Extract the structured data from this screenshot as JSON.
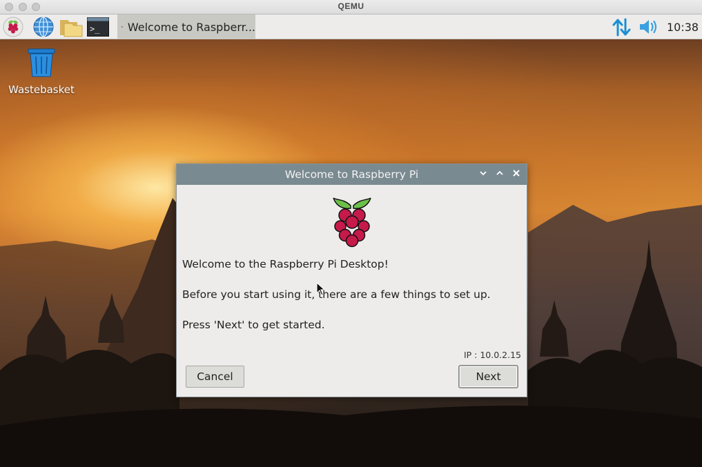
{
  "host_window": {
    "title": "QEMU"
  },
  "taskbar": {
    "launchers": [
      {
        "name": "raspberry-menu-icon"
      },
      {
        "name": "web-browser-icon"
      },
      {
        "name": "file-manager-icon"
      },
      {
        "name": "terminal-icon"
      }
    ],
    "task": {
      "label": "Welcome to Raspberr..."
    },
    "tray": {
      "network": "network-transfer-icon",
      "volume": "volume-icon",
      "clock": "10:38"
    },
    "colors": {
      "accent": "#1a8fd4"
    }
  },
  "desktop": {
    "icons": [
      {
        "label": "Wastebasket"
      }
    ]
  },
  "dialog": {
    "title": "Welcome to Raspberry Pi",
    "line1": "Welcome to the Raspberry Pi Desktop!",
    "line2": "Before you start using it, there are a few things to set up.",
    "line3": "Press 'Next' to get started.",
    "ip": "IP : 10.0.2.15",
    "buttons": {
      "cancel": "Cancel",
      "next": "Next"
    },
    "colors": {
      "titlebar": "#7a8a91",
      "raspberry": "#c51a4a",
      "leaf": "#6cc04a"
    }
  }
}
